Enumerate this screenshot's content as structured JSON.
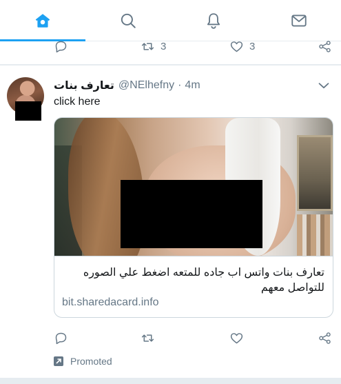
{
  "nav": {
    "tabs": [
      {
        "name": "home",
        "icon": "home-icon",
        "active": true
      },
      {
        "name": "search",
        "icon": "search-icon",
        "active": false
      },
      {
        "name": "notifications",
        "icon": "bell-icon",
        "active": false
      },
      {
        "name": "messages",
        "icon": "mail-icon",
        "active": false
      }
    ],
    "accent_color": "#1da1f2"
  },
  "previous_tweet_actions": {
    "retweet_count": "3",
    "like_count": "3"
  },
  "tweet": {
    "display_name": "تعارف بنات",
    "handle": "@NElhefny",
    "separator": "·",
    "time": "4m",
    "text": "click here",
    "card": {
      "description": "تعارف بنات واتس اب جاده للمتعه اضغط علي الصوره للتواصل معهم",
      "domain": "bit.sharedacard.info"
    },
    "promoted_label": "Promoted"
  },
  "colors": {
    "text_primary": "#14171a",
    "text_secondary": "#657786",
    "border": "#ccd6dd",
    "background": "#e6ecf0"
  }
}
